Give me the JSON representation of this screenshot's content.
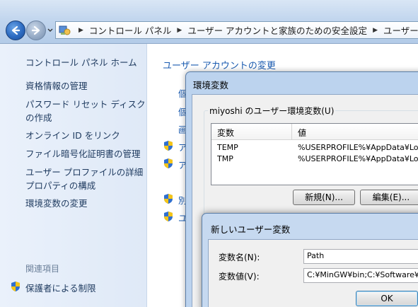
{
  "breadcrumb": {
    "items": [
      "コントロール パネル",
      "ユーザー アカウントと家族のための安全設定",
      "ユーザー ア"
    ]
  },
  "left_pane": {
    "home": "コントロール パネル ホーム",
    "links": [
      "資格情報の管理",
      "パスワード リセット ディスク\nの作成",
      "オンライン ID をリンク",
      "ファイル暗号化証明書の管理",
      "ユーザー プロファイルの詳細\nプロパティの構成",
      "環境変数の変更"
    ],
    "related_header": "関連項目",
    "parental": "保護者による制限"
  },
  "main": {
    "title": "ユーザー アカウントの変更",
    "fragments": [
      "個",
      "個",
      "画",
      "ア",
      "ア",
      "別",
      "ユ"
    ]
  },
  "env_dialog": {
    "title": "環境変数",
    "user_group_label": "miyoshi のユーザー環境変数(U)",
    "columns": [
      "変数",
      "値"
    ],
    "rows": [
      {
        "name": "TEMP",
        "value": "%USERPROFILE%¥AppData¥Local"
      },
      {
        "name": "TMP",
        "value": "%USERPROFILE%¥AppData¥Local"
      }
    ],
    "new_button": "新規(N)...",
    "edit_button": "編集(E)..."
  },
  "new_var_dialog": {
    "title": "新しいユーザー変数",
    "name_label": "変数名(N):",
    "name_value": "Path",
    "value_label": "変数値(V):",
    "value_value": "C:¥MinGW¥bin;C:¥Software¥Oct",
    "ok_button": "OK"
  },
  "colors": {
    "link": "#1a5bb0",
    "pane_bg": "#e4edf9",
    "dialog_frame": "#bcd3ee"
  }
}
